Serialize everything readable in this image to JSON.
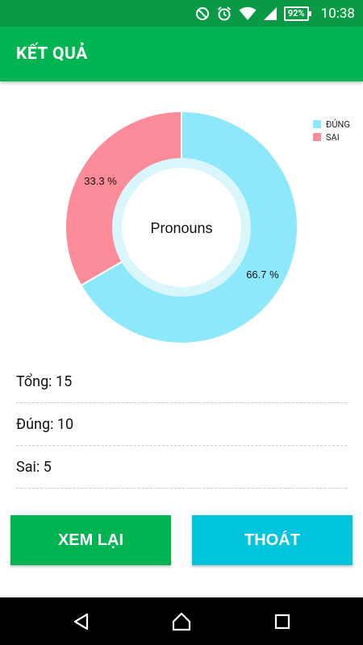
{
  "colors": {
    "status_bar": "#0a9a46",
    "app_bar": "#00b551",
    "correct": "#8ee8fb",
    "wrong": "#fc8c9a",
    "review_button": "#00b551",
    "exit_button": "#00c5dd"
  },
  "status_bar": {
    "battery": "92%",
    "time": "10:38",
    "icons": [
      "do-not-disturb-icon",
      "alarm-icon",
      "wifi-icon",
      "signal-icon",
      "battery-icon"
    ]
  },
  "app_bar": {
    "title": "KẾT QUẢ"
  },
  "chart_data": {
    "type": "pie",
    "donut": true,
    "center_label": "Pronouns",
    "legend_position": "top-right",
    "slices": [
      {
        "name": "ĐÚNG",
        "value": 10,
        "label": "66.7 %"
      },
      {
        "name": "SAI",
        "value": 5,
        "label": "33.3 %"
      }
    ]
  },
  "stats": {
    "total": "Tổng: 15",
    "correct": "Đúng: 10",
    "wrong": "Sai: 5"
  },
  "buttons": {
    "review": "XEM LẠI",
    "exit": "THOÁT"
  },
  "nav": {
    "icons": [
      "back-icon",
      "home-icon",
      "recents-icon"
    ]
  }
}
